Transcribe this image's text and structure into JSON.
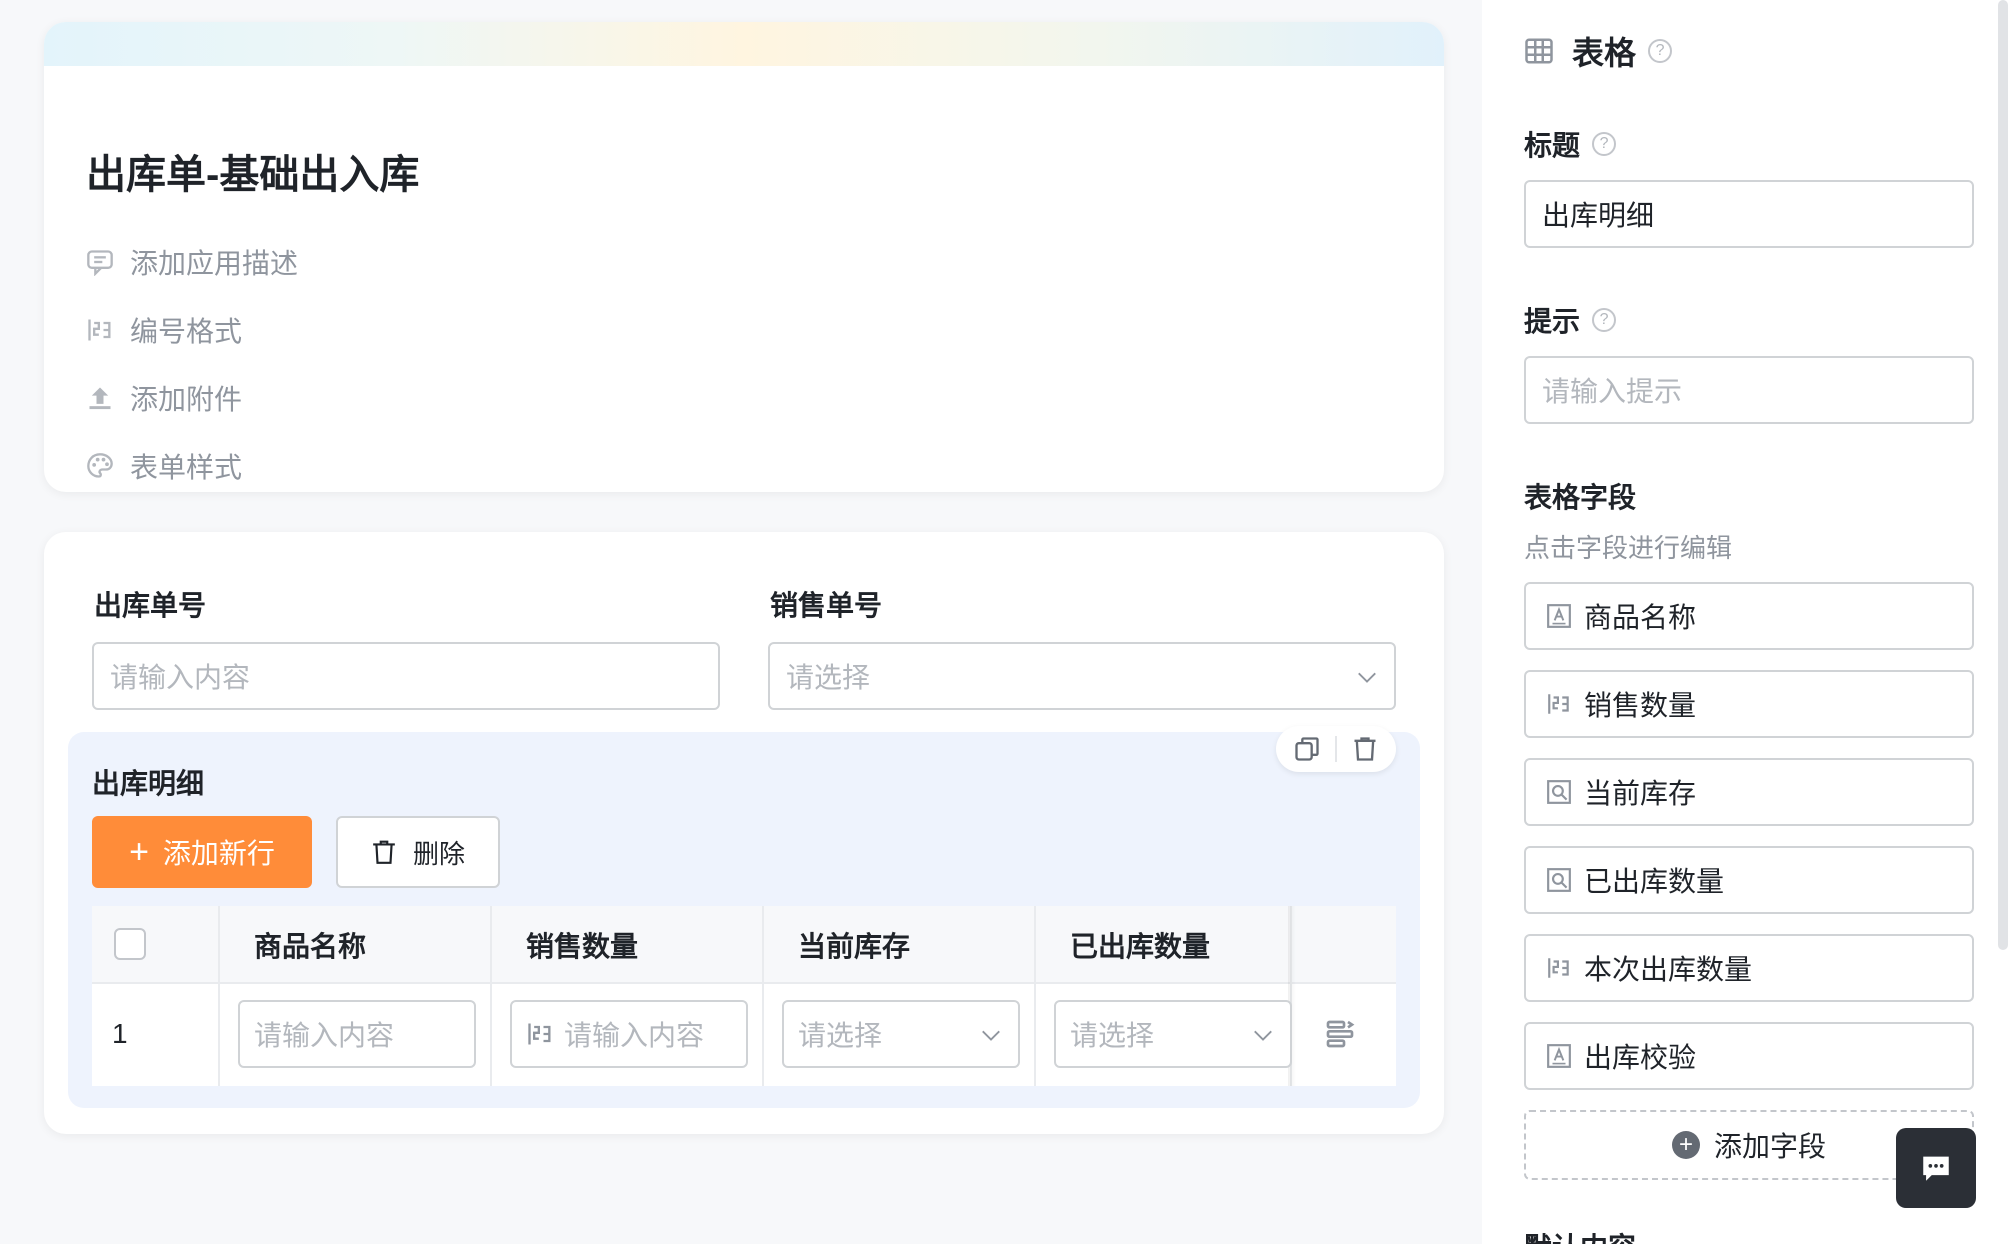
{
  "app": {
    "title": "出库单-基础出入库",
    "meta": [
      {
        "label": "添加应用描述",
        "icon": "comment-icon"
      },
      {
        "label": "编号格式",
        "icon": "number-format-icon"
      },
      {
        "label": "添加附件",
        "icon": "upload-icon"
      },
      {
        "label": "表单样式",
        "icon": "palette-icon"
      }
    ]
  },
  "form": {
    "fields": [
      {
        "label": "出库单号",
        "placeholder": "请输入内容",
        "type": "text"
      },
      {
        "label": "销售单号",
        "placeholder": "请选择",
        "type": "select"
      }
    ],
    "subtable": {
      "title": "出库明细",
      "add_row_label": "添加新行",
      "delete_label": "删除",
      "columns": [
        "商品名称",
        "销售数量",
        "当前库存",
        "已出库数量"
      ],
      "row": {
        "index": "1",
        "cells": [
          "请输入内容",
          "请输入内容",
          "请选择",
          "请选择"
        ]
      }
    }
  },
  "panel": {
    "header": "表格",
    "title_label": "标题",
    "title_value": "出库明细",
    "hint_label": "提示",
    "hint_placeholder": "请输入提示",
    "fields_label": "表格字段",
    "fields_hint": "点击字段进行编辑",
    "fields": [
      {
        "label": "商品名称",
        "icon": "text-field-icon"
      },
      {
        "label": "销售数量",
        "icon": "number-field-icon"
      },
      {
        "label": "当前库存",
        "icon": "lookup-field-icon"
      },
      {
        "label": "已出库数量",
        "icon": "lookup-field-icon"
      },
      {
        "label": "本次出库数量",
        "icon": "number-field-icon"
      },
      {
        "label": "出库校验",
        "icon": "text-field-icon"
      }
    ],
    "add_field_label": "添加字段",
    "next_section_label": "默认内容"
  },
  "colors": {
    "accent": "#ff8c39",
    "subtable_bg": "#eef3fd",
    "chat_button": "#2b2f36"
  }
}
